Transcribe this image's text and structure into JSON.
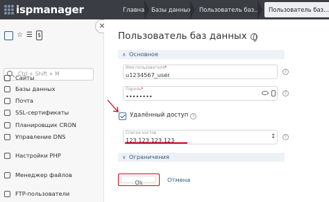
{
  "header": {
    "logo_text": "ispmanager",
    "breadcrumbs": [
      {
        "label": "Главная"
      },
      {
        "label": "Базы данных"
      },
      {
        "label": "Пользователь баз..."
      },
      {
        "label": "Пользователь баз..."
      }
    ]
  },
  "sidebar": {
    "search_placeholder": "Ctrl + Shift + M",
    "collapse_icon": "close-icon",
    "items": [
      {
        "label": "Сайты",
        "icon": "sites-icon"
      },
      {
        "label": "Базы данных",
        "icon": "database-icon"
      },
      {
        "label": "Почта",
        "icon": "mail-icon"
      },
      {
        "label": "SSL-сертификаты",
        "icon": "certificate-icon"
      },
      {
        "label": "Планировщик CRON",
        "icon": "cron-icon"
      },
      {
        "label": "Управление DNS",
        "icon": "dns-icon"
      },
      {
        "label": "Настройки PHP",
        "icon": "php-icon"
      },
      {
        "label": "Менеджер файлов",
        "icon": "file-manager-icon"
      },
      {
        "label": "FTP-пользователи",
        "icon": "ftp-icon"
      }
    ]
  },
  "main": {
    "title": "Пользователь баз данных",
    "section_main": "Основное",
    "username": {
      "label": "Имя пользователя",
      "value": "u1234567_user"
    },
    "password": {
      "label": "Пароль",
      "value": "••••••••"
    },
    "remote_access": {
      "label": "Удалённый доступ",
      "checked": true
    },
    "allowed_hosts": {
      "label": "Список хостов",
      "value": "123.123.123.123"
    },
    "section_limits": "Ограничения",
    "ok_label": "Ok",
    "cancel_label": "Отмена"
  },
  "colors": {
    "topbar": "#3a3d43",
    "accent": "#2f5a86",
    "highlight": "#d0021b"
  }
}
